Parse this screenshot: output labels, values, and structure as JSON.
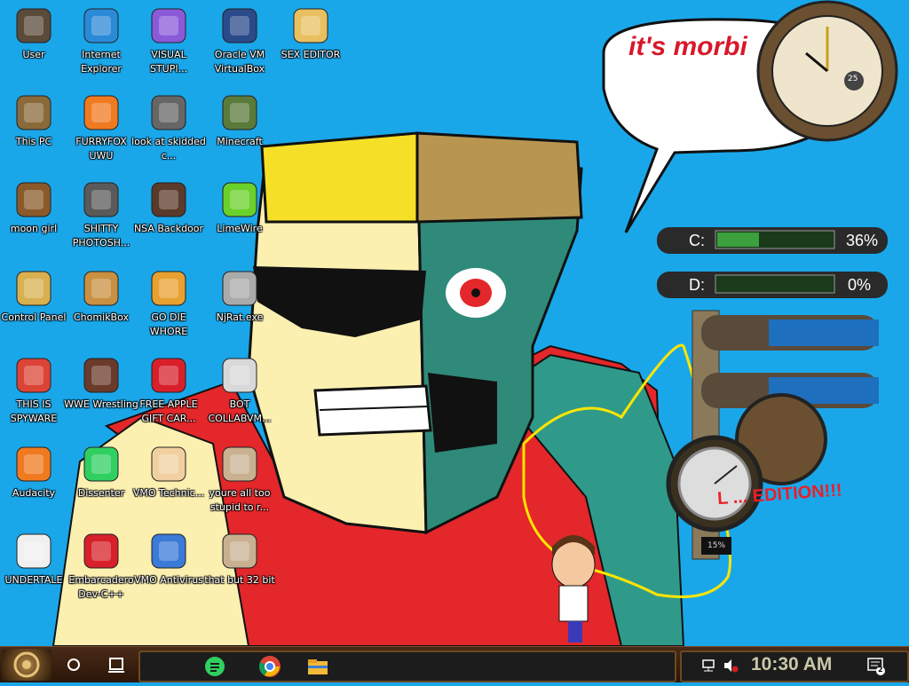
{
  "desktop": {
    "icons": [
      {
        "label": "User",
        "icon": "safe-icon"
      },
      {
        "label": "Internet Explorer",
        "icon": "edge-browser-icon"
      },
      {
        "label": "VISUAL STUPI...",
        "icon": "visual-studio-icon"
      },
      {
        "label": "Oracle VM VirtualBox",
        "icon": "virtualbox-icon"
      },
      {
        "label": "SEX EDITOR",
        "icon": "hex-editor-icon"
      },
      {
        "label": "This PC",
        "icon": "computer-icon"
      },
      {
        "label": "FURRYFOX UWU",
        "icon": "firefox-icon"
      },
      {
        "label": "look at skidded c...",
        "icon": "stacked-windows-icon"
      },
      {
        "label": "Minecraft",
        "icon": "minecraft-icon"
      },
      {
        "label": "moon girl",
        "icon": "bucket-icon"
      },
      {
        "label": "SHITTY PHOTOSH...",
        "icon": "gimp-icon"
      },
      {
        "label": "NSA Backdoor",
        "icon": "radio-box-icon"
      },
      {
        "label": "LimeWire",
        "icon": "limewire-icon"
      },
      {
        "label": "Control Panel",
        "icon": "lightbulb-icon"
      },
      {
        "label": "ChomikBox",
        "icon": "chomikbox-icon"
      },
      {
        "label": "GO DIE WHORE",
        "icon": "de-file-icon"
      },
      {
        "label": "NjRat.exe",
        "icon": "skull-icon"
      },
      {
        "label": "THIS IS SPYWARE",
        "icon": "chrome-icon"
      },
      {
        "label": "WWE Wrestling",
        "icon": "oven-icon"
      },
      {
        "label": "FREE APPLE GIFT CAR...",
        "icon": "apple-icon"
      },
      {
        "label": "BOT COLLABVM...",
        "icon": "monitor-icon"
      },
      {
        "label": "Audacity",
        "icon": "audacity-icon"
      },
      {
        "label": "Dissenter",
        "icon": "dissenter-icon"
      },
      {
        "label": "VMO Technic...",
        "icon": "doctor-icon"
      },
      {
        "label": "youre all too stupid to r...",
        "icon": "portrait-icon"
      },
      {
        "label": "UNDERTALE",
        "icon": "unity-icon"
      },
      {
        "label": "Embarcadero Dev-C++",
        "icon": "devcpp-icon"
      },
      {
        "label": "VMO Antivirus",
        "icon": "shield-icon"
      },
      {
        "label": "that but 32 bit",
        "icon": "portrait-icon"
      }
    ]
  },
  "wallpaper": {
    "speech_bubble": "it's morbi",
    "red_text": "L ... EDITION!!!"
  },
  "widgets": {
    "drive_c": {
      "label": "C:",
      "percent": 36,
      "percent_label": "36%"
    },
    "drive_d": {
      "label": "D:",
      "percent": 0,
      "percent_label": "0%"
    },
    "clock_day": "25",
    "gauge_percent": "15%"
  },
  "taskbar": {
    "pinned": [
      {
        "name": "dissenter",
        "icon": "dissenter-icon"
      },
      {
        "name": "chrome",
        "icon": "chrome-icon"
      },
      {
        "name": "file-explorer",
        "icon": "folder-icon"
      }
    ],
    "time": "10:30 AM",
    "notification_count": "2"
  },
  "colors": {
    "desktop_bg": "#1aa7ea",
    "accent_red": "#d8182a",
    "taskbar": "#3a2010"
  }
}
